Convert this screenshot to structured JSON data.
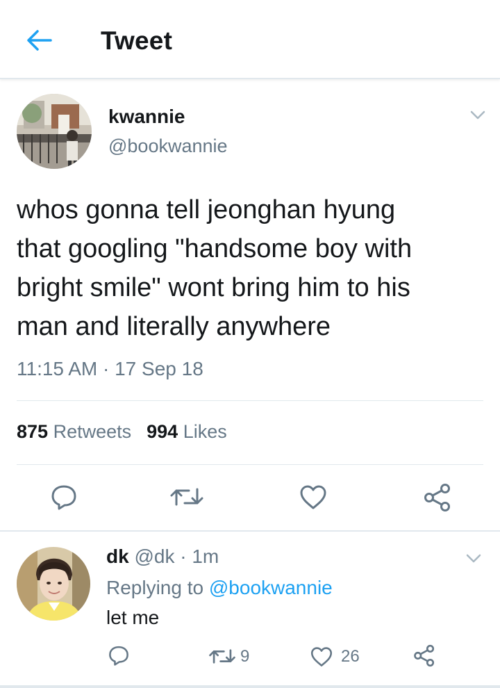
{
  "header": {
    "title": "Tweet",
    "back_icon": "back-arrow-icon",
    "accent": "#1da1f2"
  },
  "tweet": {
    "display_name": "kwannie",
    "handle": "@bookwannie",
    "text_lines": [
      "whos gonna tell jeonghan hyung",
      "that googling \"handsome boy with",
      "bright smile\" wont bring him to his",
      "man and literally anywhere"
    ],
    "timestamp": "11:15 AM · 17 Sep 18",
    "retweets_count": "875",
    "retweets_label": "Retweets",
    "likes_count": "994",
    "likes_label": "Likes",
    "actions": [
      "reply-icon",
      "retweet-icon",
      "like-icon",
      "share-icon"
    ]
  },
  "reply": {
    "name": "dk",
    "handle": "@dk",
    "time": " · 1m",
    "replying_prefix": "Replying to ",
    "replying_to": "@bookwannie",
    "text": "let me",
    "retweets": "9",
    "likes": "26"
  },
  "colors": {
    "text": "#14171a",
    "muted": "#657786",
    "border": "#e1e8ed",
    "accent": "#1da1f2"
  }
}
